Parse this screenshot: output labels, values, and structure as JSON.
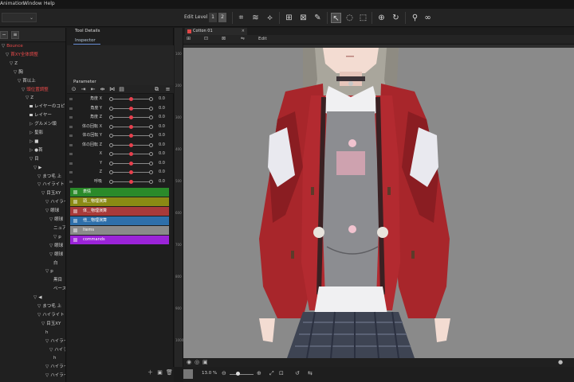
{
  "menubar": {
    "items": [
      "Animation",
      "Window",
      "Help"
    ]
  },
  "toolbar": {
    "edit_level_label": "Edit Level",
    "edit_level_buttons": [
      "1",
      "2"
    ]
  },
  "left_panel": {
    "tree": [
      {
        "label": "Bounce",
        "indent": 0,
        "red": true,
        "arrow": "▽"
      },
      {
        "label": "首XY全体調整",
        "indent": 1,
        "red": true,
        "arrow": "▽"
      },
      {
        "label": "Z",
        "indent": 2,
        "arrow": "▽"
      },
      {
        "label": "胸",
        "indent": 3,
        "arrow": "▽"
      },
      {
        "label": "首以上",
        "indent": 4,
        "arrow": "▽"
      },
      {
        "label": "頭位置調整",
        "indent": 5,
        "red": true,
        "arrow": "▽"
      },
      {
        "label": "Z",
        "indent": 6,
        "arrow": "▽"
      },
      {
        "label": "レイヤーのコピー",
        "indent": 7,
        "eye": true
      },
      {
        "label": "レイヤー",
        "indent": 7,
        "eye": true
      },
      {
        "label": "グルメン頭",
        "indent": 7,
        "arrow": "▷"
      },
      {
        "label": "髪影",
        "indent": 7,
        "arrow": "▷"
      },
      {
        "label": "■",
        "indent": 7,
        "arrow": "▷"
      },
      {
        "label": "●首",
        "indent": 7,
        "arrow": "▷"
      },
      {
        "label": "目",
        "indent": 7,
        "arrow": "▽"
      },
      {
        "label": "▶",
        "indent": 8,
        "arrow": "▽"
      },
      {
        "label": "まつ毛 上",
        "indent": 9,
        "arrow": "▽"
      },
      {
        "label": "ハイライト",
        "indent": 9,
        "arrow": "▽"
      },
      {
        "label": "目玉XY",
        "indent": 10,
        "arrow": "▽"
      },
      {
        "label": "ハイライト",
        "indent": 11,
        "arrow": "▽"
      },
      {
        "label": "眼球",
        "indent": 11,
        "arrow": "▽"
      },
      {
        "label": "眼球",
        "indent": 12,
        "arrow": "▽"
      },
      {
        "label": "ニュアンス",
        "indent": 13
      },
      {
        "label": "p",
        "indent": 13,
        "arrow": "▽"
      },
      {
        "label": "眼球",
        "indent": 12,
        "arrow": "▽"
      },
      {
        "label": "眼球",
        "indent": 12,
        "arrow": "▽"
      },
      {
        "label": "白",
        "indent": 13
      },
      {
        "label": "p",
        "indent": 11,
        "arrow": "▽"
      },
      {
        "label": "黒目",
        "indent": 13
      },
      {
        "label": "ベース",
        "indent": 13
      },
      {
        "label": "◀",
        "indent": 8,
        "arrow": "▽"
      },
      {
        "label": "まつ毛 上",
        "indent": 9,
        "arrow": "▽"
      },
      {
        "label": "ハイライト",
        "indent": 9,
        "arrow": "▽"
      },
      {
        "label": "目玉XY",
        "indent": 10,
        "arrow": "▽"
      },
      {
        "label": "h",
        "indent": 11
      },
      {
        "label": "ハイライト",
        "indent": 11,
        "arrow": "▽"
      },
      {
        "label": "ハイライト",
        "indent": 12,
        "arrow": "▽"
      },
      {
        "label": "h",
        "indent": 13
      },
      {
        "label": "ハイライト",
        "indent": 11,
        "arrow": "▽"
      },
      {
        "label": "ハイライト",
        "indent": 11,
        "arrow": "▽"
      }
    ]
  },
  "mid_panel": {
    "tool_details_tab": "Tool Details",
    "inspector_tab": "Inspector",
    "parameter_tab": "Parameter",
    "params": [
      {
        "name": "角度 X",
        "value": "0.0",
        "pos": 0.5
      },
      {
        "name": "角度 Y",
        "value": "0.0",
        "pos": 0.5
      },
      {
        "name": "角度 Z",
        "value": "0.0",
        "pos": 0.5
      },
      {
        "name": "体の回転 X",
        "value": "0.0",
        "pos": 0.5
      },
      {
        "name": "体の回転 Y",
        "value": "0.0",
        "pos": 0.5
      },
      {
        "name": "体の回転 Z",
        "value": "0.0",
        "pos": 0.5
      },
      {
        "name": "X",
        "value": "0.0",
        "pos": 0.5
      },
      {
        "name": "Y",
        "value": "0.0",
        "pos": 0.5
      },
      {
        "name": "Z",
        "value": "0.0",
        "pos": 0.5
      },
      {
        "name": "呼吸",
        "value": "0.0",
        "pos": 0.5
      }
    ],
    "groups": [
      {
        "label": "表情",
        "color": "#2a8a2a"
      },
      {
        "label": "頭＿物理演算",
        "color": "#8a8a14"
      },
      {
        "label": "体＿物理演算",
        "color": "#a83a3a"
      },
      {
        "label": "他＿物理演算",
        "color": "#2e6faa"
      },
      {
        "label": "Items",
        "color": "#8a8a8a"
      },
      {
        "label": "commands",
        "color": "#9b24d8"
      }
    ]
  },
  "canvas": {
    "doc_tab": "Cotton 01",
    "view_label": "Edit",
    "background": "#8a8a8a"
  },
  "zoom": {
    "value": "13.0 %"
  },
  "ruler": {
    "ticks": [
      "100",
      "200",
      "300",
      "400",
      "500",
      "600",
      "700",
      "800",
      "900",
      "1000"
    ]
  }
}
